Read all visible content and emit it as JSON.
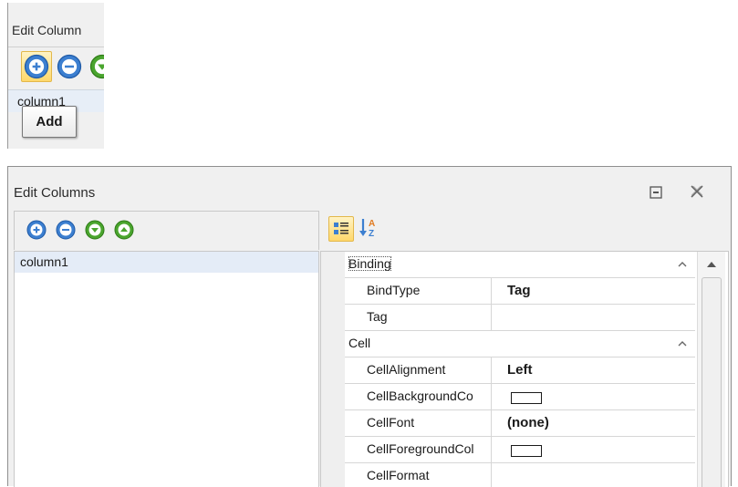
{
  "snippet": {
    "title": "Edit Column",
    "list_item": "column1",
    "tooltip": "Add"
  },
  "dialog": {
    "title": "Edit Columns",
    "toolbar": {
      "buttons": [
        {
          "icon": "add-icon"
        },
        {
          "icon": "remove-icon"
        },
        {
          "icon": "move-down-icon"
        },
        {
          "icon": "move-up-icon"
        }
      ]
    },
    "columns": [
      "column1"
    ],
    "property_toolbar": {
      "buttons": [
        {
          "icon": "categorized-icon",
          "active": true
        },
        {
          "icon": "alphabetical-sort-icon",
          "active": false
        }
      ]
    },
    "properties": {
      "binding": {
        "label": "Binding",
        "rows": [
          {
            "name": "BindType",
            "value": "Tag"
          },
          {
            "name": "Tag",
            "value": ""
          }
        ]
      },
      "cell": {
        "label": "Cell",
        "rows": [
          {
            "name": "CellAlignment",
            "value": "Left"
          },
          {
            "name": "CellBackgroundCo",
            "value": ""
          },
          {
            "name": "CellFont",
            "value": "(none)"
          },
          {
            "name": "CellForegroundCol",
            "value": ""
          },
          {
            "name": "CellFormat",
            "value": ""
          }
        ]
      }
    }
  },
  "colors": {
    "add_blue": "#3c7fd0",
    "move_green": "#4aa52e",
    "selection": "#e4ecf7",
    "highlight": "#ffd86b"
  }
}
